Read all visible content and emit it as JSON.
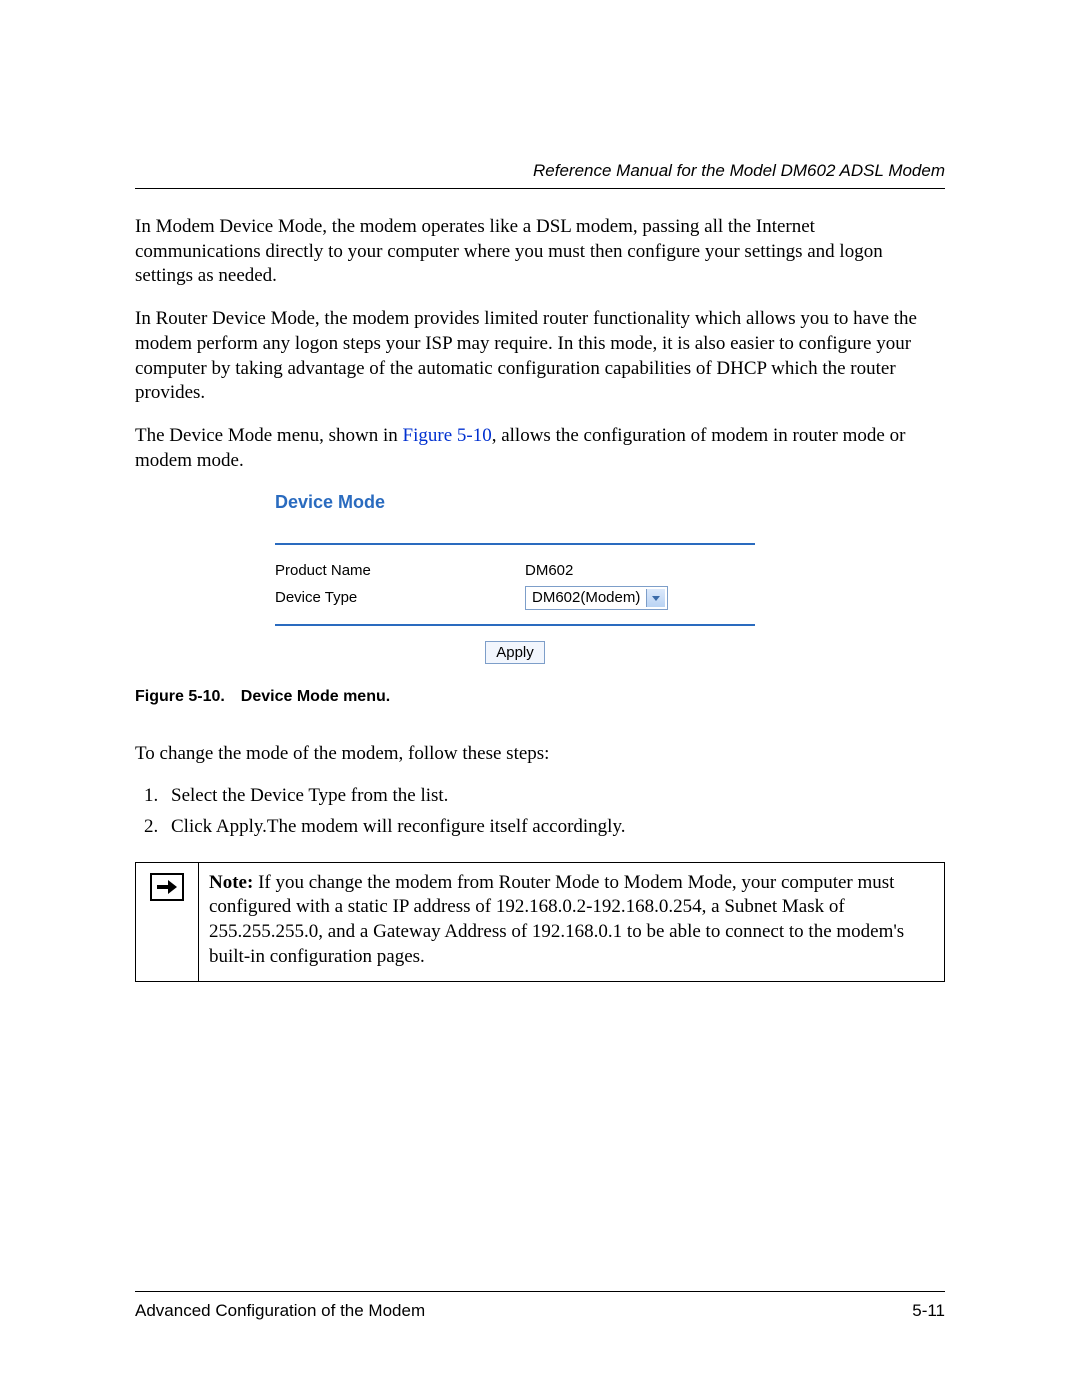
{
  "header": {
    "running_title": "Reference Manual for the Model DM602 ADSL Modem"
  },
  "paragraphs": {
    "p1": "In Modem Device Mode, the modem operates like a DSL modem, passing all the Internet communications directly to your computer where you must then configure your settings and logon settings as needed.",
    "p2": "In Router Device Mode, the modem provides limited router functionality which allows you to have the modem perform any logon steps your ISP may require. In this mode, it is also easier to configure your computer by taking advantage of the automatic configuration capabilities of DHCP which the router provides.",
    "p3_a": "The Device Mode menu, shown in ",
    "p3_link": "Figure 5-10",
    "p3_b": ", allows the configuration of modem in router mode or modem mode."
  },
  "figure": {
    "panel_title": "Device Mode",
    "row1_label": "Product Name",
    "row1_value": "DM602",
    "row2_label": "Device Type",
    "row2_select_value": "DM602(Modem)",
    "apply_label": "Apply",
    "caption": "Figure 5-10. Device Mode menu."
  },
  "steps": {
    "intro": "To change the mode of the modem, follow these steps:",
    "s1": "Select the Device Type from the list.",
    "s2": "Click Apply.The modem will reconfigure itself accordingly."
  },
  "note": {
    "label": "Note:",
    "text": " If you change the modem from Router Mode to Modem Mode, your computer must configured with a static IP address of 192.168.0.2-192.168.0.254, a Subnet Mask of 255.255.255.0, and a Gateway Address of 192.168.0.1 to be able to connect to the modem's built-in configuration pages."
  },
  "footer": {
    "section": "Advanced Configuration of the Modem",
    "page": "5-11"
  }
}
